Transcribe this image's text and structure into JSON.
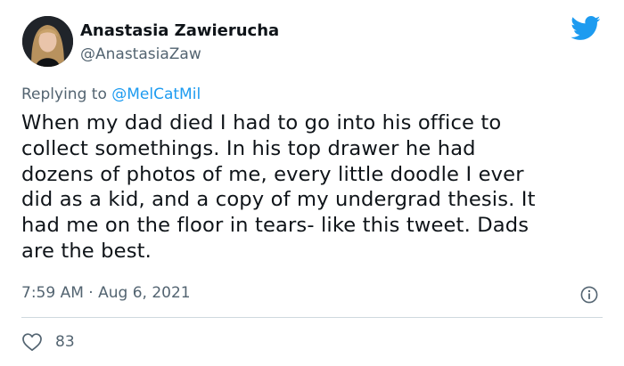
{
  "author": {
    "display_name": "Anastasia Zawierucha",
    "handle": "@AnastasiaZaw"
  },
  "reply": {
    "prefix": "Replying to ",
    "to": "@MelCatMil"
  },
  "tweet": {
    "lines": [
      "When my dad died I had to go into his office to",
      "collect somethings. In his top drawer he had",
      "dozens of photos of me, every little doodle I ever",
      "did as a kid, and a copy of my undergrad thesis. It",
      "had me on the floor in tears- like this tweet. Dads",
      "are the best."
    ],
    "time": "7:59 AM",
    "separator": " · ",
    "date": "Aug 6, 2021"
  },
  "engagement": {
    "likes": "83"
  },
  "icons": {
    "brand": "twitter-bird-icon",
    "info": "info-icon",
    "like": "heart-icon"
  },
  "colors": {
    "brand_blue": "#1d9bf0",
    "text": "#0f1419",
    "secondary": "#536471",
    "divider": "#cfd9de"
  }
}
